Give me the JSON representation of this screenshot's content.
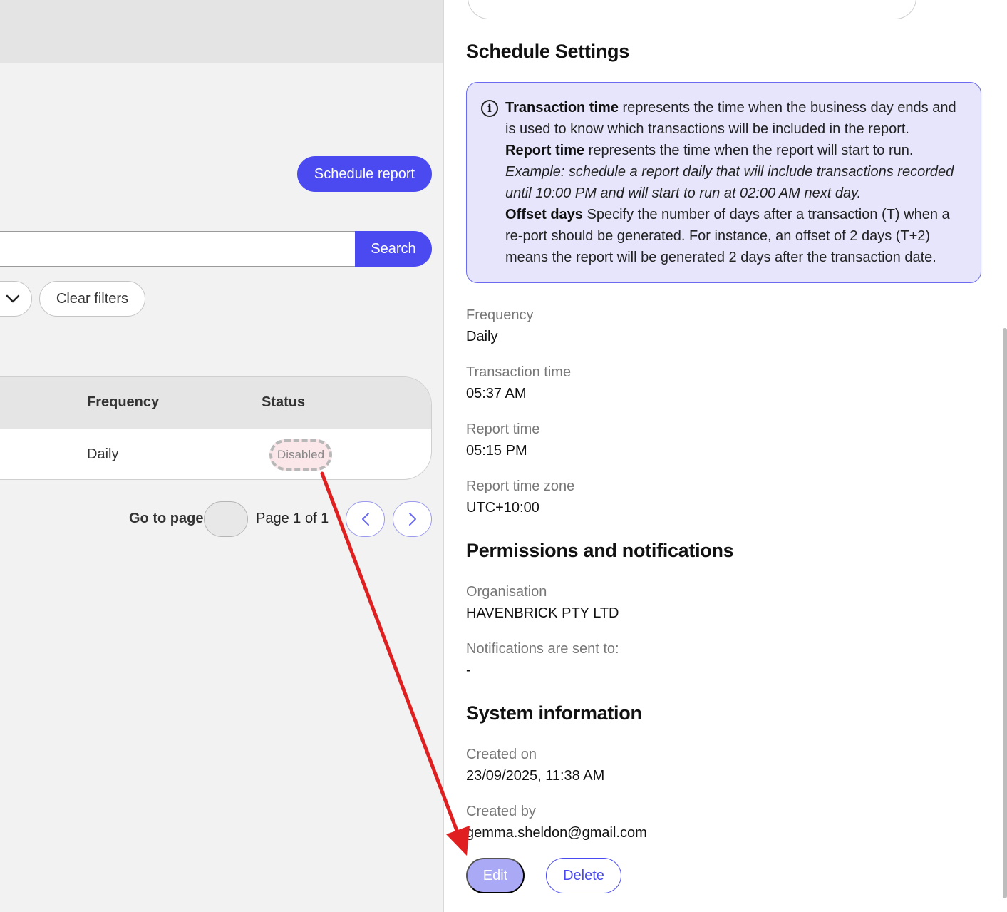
{
  "left": {
    "schedule_button": "Schedule report",
    "search_button": "Search",
    "search_placeholder": "",
    "clear_filters": "Clear filters",
    "table": {
      "headers": [
        "Frequency",
        "Status"
      ],
      "rows": [
        {
          "frequency": "Daily",
          "status": "Disabled"
        }
      ]
    },
    "pagination": {
      "go_to_label": "Go to page",
      "page_info": "Page 1 of 1"
    }
  },
  "right": {
    "schedule_title": "Schedule Settings",
    "info": {
      "transaction_time_bold": "Transaction time",
      "transaction_time_text": " represents the time when the business day ends and is used to know which transactions will be included in the report.",
      "report_time_bold": "Report time",
      "report_time_text": " represents the time when the report will start to run.",
      "example_text": "Example: schedule a report daily that will include transactions recorded until 10:00 PM and will start to run at 02:00 AM next day.",
      "offset_bold": "Offset days",
      "offset_text_1": " Specify the number of days after a transaction (T) when a re-",
      "offset_text_2": "port should be generated. For instance, an offset of 2 days (T+2) means the report will be generated 2 days after the transaction date."
    },
    "fields": {
      "frequency_label": "Frequency",
      "frequency_value": "Daily",
      "transaction_time_label": "Transaction time",
      "transaction_time_value": "05:37 AM",
      "report_time_label": "Report time",
      "report_time_value": "05:15 PM",
      "report_tz_label": "Report time zone",
      "report_tz_value": "UTC+10:00"
    },
    "permissions_title": "Permissions and notifications",
    "permissions": {
      "organisation_label": "Organisation",
      "organisation_value": "HAVENBRICK PTY LTD",
      "notifications_label": "Notifications are sent to:",
      "notifications_value": "-"
    },
    "system_title": "System information",
    "system": {
      "created_on_label": "Created on",
      "created_on_value": "23/09/2025, 11:38 AM",
      "created_by_label": "Created by",
      "created_by_value": "gemma.sheldon@gmail.com"
    },
    "edit_button": "Edit",
    "delete_button": "Delete"
  },
  "colors": {
    "accent": "#4a4af0",
    "accent_light": "#a9a9f6",
    "info_bg": "#e6e5fc",
    "annotation_arrow": "#e02020",
    "disabled_badge_bg": "#fbe6ea"
  },
  "icons": [
    "chevron-down-icon",
    "chevron-left-icon",
    "chevron-right-icon",
    "info-icon",
    "annotation-arrow"
  ]
}
